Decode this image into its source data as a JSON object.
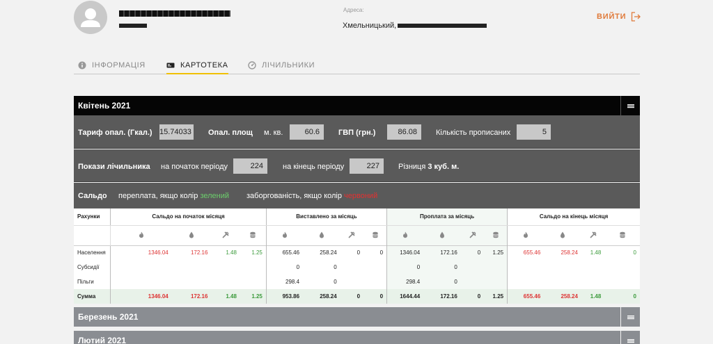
{
  "header": {
    "user_id": "",
    "address_label": "Адреса:",
    "address_city": "Хмельницький,",
    "logout_label": "ВИЙТИ"
  },
  "tabs": [
    {
      "label": "ІНФОРМАЦІЯ",
      "icon": "info-icon",
      "active": false
    },
    {
      "label": "КАРТОТЕКА",
      "icon": "card-icon",
      "active": true
    },
    {
      "label": "ЛІЧИЛЬНИКИ",
      "icon": "gauge-icon",
      "active": false
    }
  ],
  "current_month": {
    "title": "Квітень 2021",
    "tariff_label": "Тариф опал. (Гкал.)",
    "tariff_value": "15.74033",
    "area_label": "Опал. площ",
    "area_unit": "м. кв.",
    "area_value": "60.6",
    "hot_water_label": "ГВП (грн.)",
    "hot_water_value": "86.08",
    "residents_label": "Кількість прописаних",
    "residents_value": "5",
    "meter_label": "Покази лічильника",
    "meter_start_label": "на початок періоду",
    "meter_start_value": "224",
    "meter_end_label": "на кінець періоду",
    "meter_end_value": "227",
    "diff_label": "Різниця",
    "diff_value": "3 куб. м.",
    "balance_label": "Сальдо",
    "overpay_text": "переплата, якщо колір",
    "overpay_color_word": "зелений",
    "debt_text": "заборгованість, якщо колір",
    "debt_color_word": "червоний"
  },
  "table": {
    "accounts_header": "Рахунки",
    "groups": [
      "Сальдо на початок місяця",
      "Виставлено за місяць",
      "Проплата за місяць",
      "Сальдо на кінець місяця"
    ],
    "subcolumn_icons": [
      "flame-icon",
      "drop-icon",
      "tools-icon",
      "coins-icon"
    ],
    "rows": [
      {
        "label": "Населення",
        "cells": [
          "1346.04",
          "172.16",
          "1.48",
          "1.25",
          "655.46",
          "258.24",
          "0",
          "0",
          "1346.04",
          "172.16",
          "0",
          "1.25",
          "655.46",
          "258.24",
          "1.48",
          "0"
        ]
      },
      {
        "label": "Субсидії",
        "cells": [
          "",
          "",
          "",
          "",
          "0",
          "0",
          "",
          "",
          "0",
          "0",
          "",
          "",
          "",
          "",
          "",
          ""
        ]
      },
      {
        "label": "Пільги",
        "cells": [
          "",
          "",
          "",
          "",
          "298.4",
          "0",
          "",
          "",
          "298.4",
          "0",
          "",
          "",
          "",
          "",
          "",
          ""
        ]
      },
      {
        "label": "Сумма",
        "cells": [
          "1346.04",
          "172.16",
          "1.48",
          "1.25",
          "953.86",
          "258.24",
          "0",
          "0",
          "1644.44",
          "172.16",
          "0",
          "1.25",
          "655.46",
          "258.24",
          "1.48",
          "0"
        ]
      }
    ]
  },
  "collapsed_months": [
    {
      "title": "Березень 2021"
    },
    {
      "title": "Лютий 2021"
    }
  ],
  "colors": {
    "accent_orange": "#e07a3a",
    "tab_underline": "#f0c000",
    "debt_red": "#dd3333",
    "overpay_green": "#3a9a3a"
  }
}
